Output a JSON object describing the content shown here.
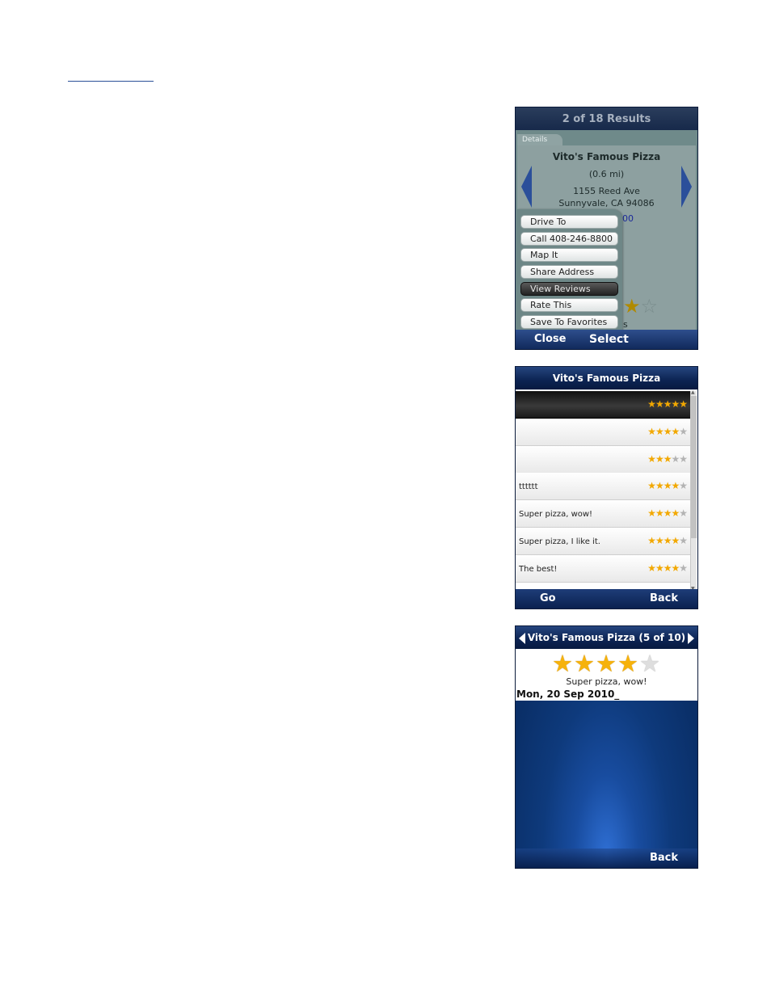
{
  "screen1": {
    "title": "2 of 18 Results",
    "tab": "Details",
    "name": "Vito's Famous Pizza",
    "distance": "(0.6 mi)",
    "address1": "1155 Reed Ave",
    "address2": "Sunnyvale, CA 94086",
    "partial_link": "00",
    "partial_s": "s",
    "menu": [
      {
        "label": "Drive To",
        "selected": false
      },
      {
        "label": "Call 408-246-8800",
        "selected": false
      },
      {
        "label": "Map It",
        "selected": false
      },
      {
        "label": "Share Address",
        "selected": false
      },
      {
        "label": "View Reviews",
        "selected": true
      },
      {
        "label": "Rate This",
        "selected": false
      },
      {
        "label": "Save To Favorites",
        "selected": false
      }
    ],
    "softkeys": {
      "left": "Close",
      "right": "Select"
    },
    "colors": {
      "title_bar": "#17294a",
      "menu_selected": "#222222"
    }
  },
  "screen2": {
    "title": "Vito's Famous Pizza",
    "reviews": [
      {
        "text": "",
        "rating": 5,
        "selected": true
      },
      {
        "text": "",
        "rating": 4,
        "selected": false
      },
      {
        "text": "",
        "rating": 3,
        "selected": false
      },
      {
        "text": "tttttt",
        "rating": 4,
        "selected": false
      },
      {
        "text": "Super pizza, wow!",
        "rating": 4,
        "selected": false
      },
      {
        "text": "Super pizza, I like it.",
        "rating": 4,
        "selected": false
      },
      {
        "text": "The best!",
        "rating": 4,
        "selected": false
      }
    ],
    "softkeys": {
      "left": "Go",
      "right": "Back"
    },
    "colors": {
      "star_on": "#f2a800",
      "star_off": "#b3b3b3"
    }
  },
  "screen3": {
    "title": "Vito's Famous Pizza (5 of 10)",
    "rating": 4,
    "max_rating": 5,
    "review_text": "Super pizza, wow!",
    "date": "Mon, 20 Sep 2010_",
    "softkeys": {
      "right": "Back"
    },
    "colors": {
      "background": "#0e3a7c"
    }
  },
  "icons": [
    "left-arrow-icon",
    "right-arrow-icon",
    "star-icon",
    "scroll-up-icon",
    "scroll-down-icon"
  ]
}
